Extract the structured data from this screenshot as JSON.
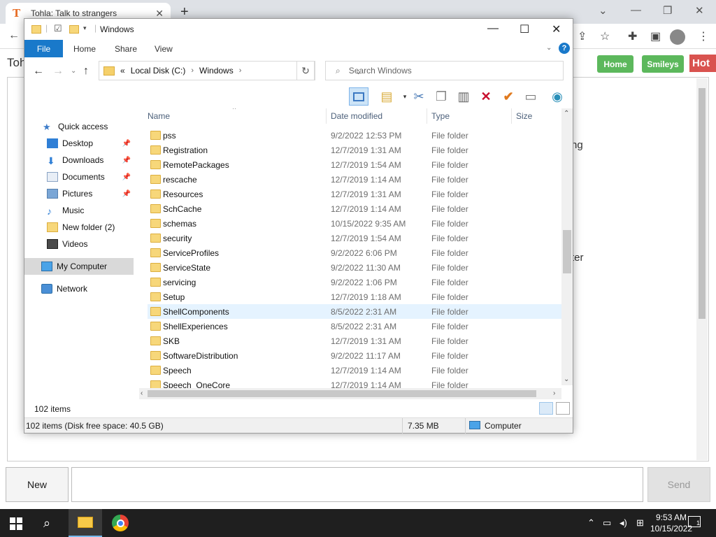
{
  "browser": {
    "tab_title": "Tohla: Talk to strangers",
    "tab_favicon": "T",
    "close_glyph": "✕",
    "new_tab_glyph": "+"
  },
  "page": {
    "title": "Tohl",
    "nav_home": "Home",
    "nav_smileys": "Smileys",
    "nav_hot": "Hot",
    "chat_fragment_1": "ng",
    "chat_fragment_2": "ter",
    "new_button": "New",
    "send_button": "Send",
    "chat_input_value": ""
  },
  "explorer": {
    "window_title": "Windows",
    "ribbon_tabs": {
      "file": "File",
      "home": "Home",
      "share": "Share",
      "view": "View"
    },
    "address": {
      "prefix": "«",
      "drive": "Local Disk (C:)",
      "folder": "Windows"
    },
    "search_placeholder": "Search Windows",
    "columns": {
      "name": "Name",
      "date": "Date modified",
      "type": "Type",
      "size": "Size"
    },
    "nav": [
      {
        "label": "Quick access",
        "icon": "star-icon",
        "pinned": false
      },
      {
        "label": "Desktop",
        "icon": "desktop-icon",
        "pinned": true
      },
      {
        "label": "Downloads",
        "icon": "download-icon",
        "pinned": true
      },
      {
        "label": "Documents",
        "icon": "document-icon",
        "pinned": true
      },
      {
        "label": "Pictures",
        "icon": "picture-icon",
        "pinned": true
      },
      {
        "label": "Music",
        "icon": "music-icon",
        "pinned": false
      },
      {
        "label": "New folder (2)",
        "icon": "folder-icon",
        "pinned": false
      },
      {
        "label": "Videos",
        "icon": "video-icon",
        "pinned": false
      },
      {
        "label": "My Computer",
        "icon": "computer-icon",
        "pinned": false
      },
      {
        "label": "Network",
        "icon": "network-icon",
        "pinned": false
      }
    ],
    "files": [
      {
        "name": "pss",
        "date": "9/2/2022 12:53 PM",
        "type": "File folder"
      },
      {
        "name": "Registration",
        "date": "12/7/2019 1:31 AM",
        "type": "File folder"
      },
      {
        "name": "RemotePackages",
        "date": "12/7/2019 1:54 AM",
        "type": "File folder"
      },
      {
        "name": "rescache",
        "date": "12/7/2019 1:14 AM",
        "type": "File folder"
      },
      {
        "name": "Resources",
        "date": "12/7/2019 1:31 AM",
        "type": "File folder"
      },
      {
        "name": "SchCache",
        "date": "12/7/2019 1:14 AM",
        "type": "File folder"
      },
      {
        "name": "schemas",
        "date": "10/15/2022 9:35 AM",
        "type": "File folder"
      },
      {
        "name": "security",
        "date": "12/7/2019 1:54 AM",
        "type": "File folder"
      },
      {
        "name": "ServiceProfiles",
        "date": "9/2/2022 6:06 PM",
        "type": "File folder"
      },
      {
        "name": "ServiceState",
        "date": "9/2/2022 11:30 AM",
        "type": "File folder"
      },
      {
        "name": "servicing",
        "date": "9/2/2022 1:06 PM",
        "type": "File folder"
      },
      {
        "name": "Setup",
        "date": "12/7/2019 1:18 AM",
        "type": "File folder"
      },
      {
        "name": "ShellComponents",
        "date": "8/5/2022 2:31 AM",
        "type": "File folder"
      },
      {
        "name": "ShellExperiences",
        "date": "8/5/2022 2:31 AM",
        "type": "File folder"
      },
      {
        "name": "SKB",
        "date": "12/7/2019 1:31 AM",
        "type": "File folder"
      },
      {
        "name": "SoftwareDistribution",
        "date": "9/2/2022 11:17 AM",
        "type": "File folder"
      },
      {
        "name": "Speech",
        "date": "12/7/2019 1:14 AM",
        "type": "File folder"
      },
      {
        "name": "Speech_OneCore",
        "date": "12/7/2019 1:14 AM",
        "type": "File folder"
      }
    ],
    "highlighted_row": 12,
    "item_count": "102 items",
    "status": {
      "disk": "102 items (Disk free space: 40.5 GB)",
      "size": "7.35 MB",
      "location": "Computer"
    }
  },
  "taskbar": {
    "time": "9:53 AM",
    "date": "10/15/2022",
    "notification_count": "1"
  },
  "colors": {
    "accent": "#1979ca",
    "green_button": "#5cb85c",
    "hot_button": "#d9534f",
    "row_highlight": "#e5f3ff"
  }
}
